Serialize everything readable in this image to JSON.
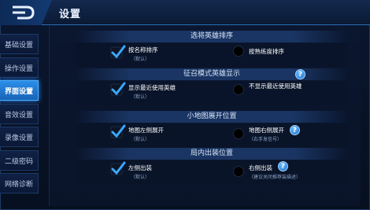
{
  "header": {
    "title": "设置"
  },
  "sidebar": {
    "items": [
      {
        "label": "基础设置"
      },
      {
        "label": "操作设置"
      },
      {
        "label": "界面设置"
      },
      {
        "label": "音效设置"
      },
      {
        "label": "录像设置"
      },
      {
        "label": "二级密码"
      },
      {
        "label": "网络诊断"
      }
    ],
    "active_index": 2
  },
  "sections": [
    {
      "title": "选将英雄排序",
      "left": {
        "label": "按名称排序",
        "sub": "（默认）",
        "checked": true
      },
      "right": {
        "label": "按熟练度排序",
        "sub": "",
        "checked": false
      },
      "help": false
    },
    {
      "title": "征召模式英雄显示",
      "left": {
        "label": "显示最近使用英雄",
        "sub": "（默认）",
        "checked": true
      },
      "right": {
        "label": "不显示最近使用英雄",
        "sub": "",
        "checked": false
      },
      "help": true
    },
    {
      "title": "小地图展开位置",
      "left": {
        "label": "地图左侧展开",
        "sub": "（默认）",
        "checked": true
      },
      "right": {
        "label": "地图右侧展开",
        "sub": "（右手发信号）",
        "checked": false
      },
      "help": true
    },
    {
      "title": "局内出装位置",
      "left": {
        "label": "左侧出装",
        "sub": "（默认）",
        "checked": true
      },
      "right": {
        "label": "右侧出装",
        "sub": "（建议关闭推荐装描述）",
        "checked": false
      },
      "help": true
    }
  ],
  "colors": {
    "accent": "#2b8ee8",
    "check": "#3aa8ff",
    "help": "#1a6fd0"
  }
}
